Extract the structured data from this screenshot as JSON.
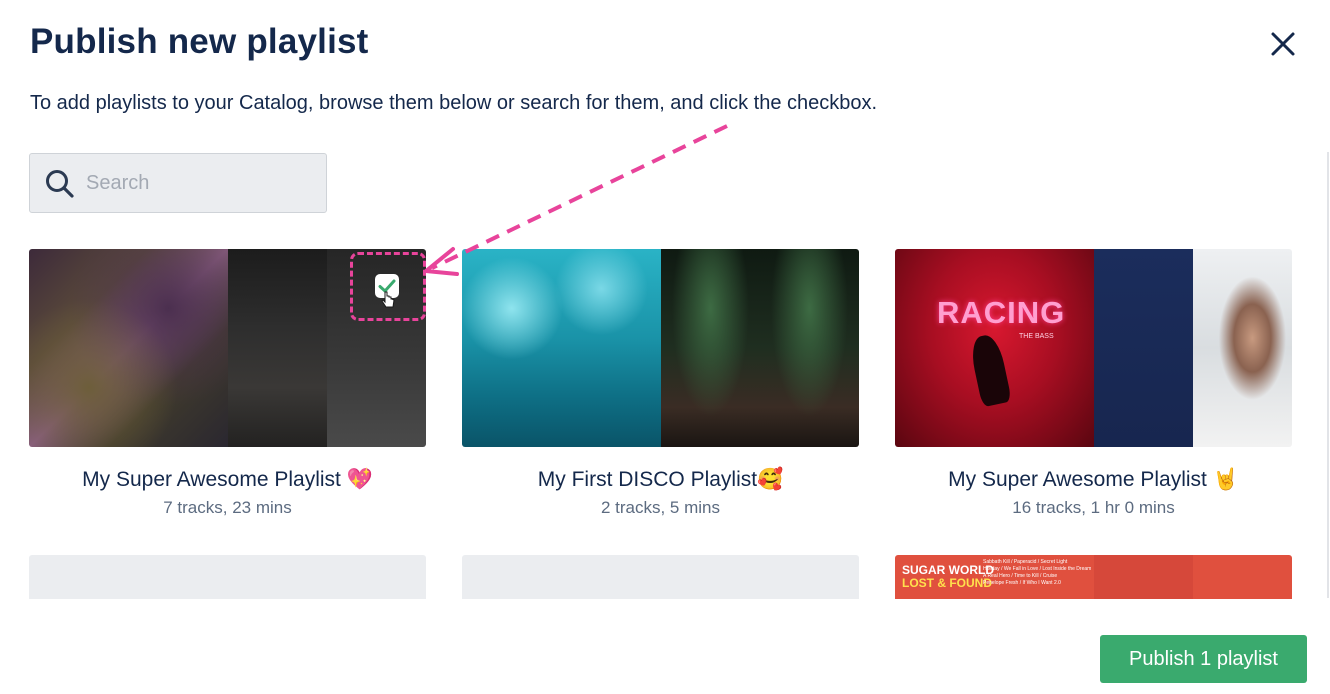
{
  "dialog": {
    "title": "Publish new playlist",
    "instructions": "To add playlists to your Catalog, browse them below or search for them, and click the checkbox."
  },
  "search": {
    "placeholder": "Search",
    "value": ""
  },
  "playlists": [
    {
      "title": "My Super Awesome Playlist 💖",
      "meta": "7 tracks, 23 mins",
      "selected": true
    },
    {
      "title": "My First DISCO Playlist🥰",
      "meta": "2 tracks, 5 mins",
      "selected": false
    },
    {
      "title": "My Super Awesome Playlist 🤘",
      "meta": "16 tracks, 1 hr 0 mins",
      "selected": false
    }
  ],
  "cover_art": {
    "racing_text": "RACING",
    "racing_sub": "THE BASS",
    "sugar_title_line1": "SUGAR WORLD",
    "sugar_title_line2": "LOST & FOUND",
    "sugar_tracks": "Sabbath Kill / Paperacid / Secret Light\nHoliday / We Fall in Love / Lost Inside the Dream\nA Real Hero / Time to Kill / Cruise\nPenelope Fresh / If Who I Want 2.0"
  },
  "footer": {
    "publish_label": "Publish 1 playlist"
  },
  "colors": {
    "heading": "#14284b",
    "muted": "#5c6b80",
    "accent_green": "#3aaa6e",
    "annotation_pink": "#e8449b",
    "input_bg": "#ebedf0"
  }
}
